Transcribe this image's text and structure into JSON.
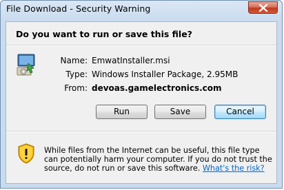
{
  "window": {
    "title": "File Download - Security Warning"
  },
  "dialog": {
    "question": "Do you want to run or save this file?",
    "file": {
      "icon": "windows-installer-package-icon",
      "name_label": "Name:",
      "name_value": "EmwatInstaller.msi",
      "type_label": "Type:",
      "type_value": "Windows Installer Package, 2.95MB",
      "from_label": "From:",
      "from_value": "devoas.gamelectronics.com"
    },
    "buttons": {
      "run": "Run",
      "save": "Save",
      "cancel": "Cancel"
    },
    "warning": {
      "icon": "security-shield-icon",
      "text": "While files from the Internet can be useful, this file type can potentially harm your computer. If you do not trust the source, do not run or save this software.",
      "link": "What's the risk?"
    }
  },
  "colors": {
    "frame": "#c9dbef",
    "link": "#0066cc",
    "close_button": "#c23a1d",
    "default_button_border": "#3c7fb1"
  }
}
